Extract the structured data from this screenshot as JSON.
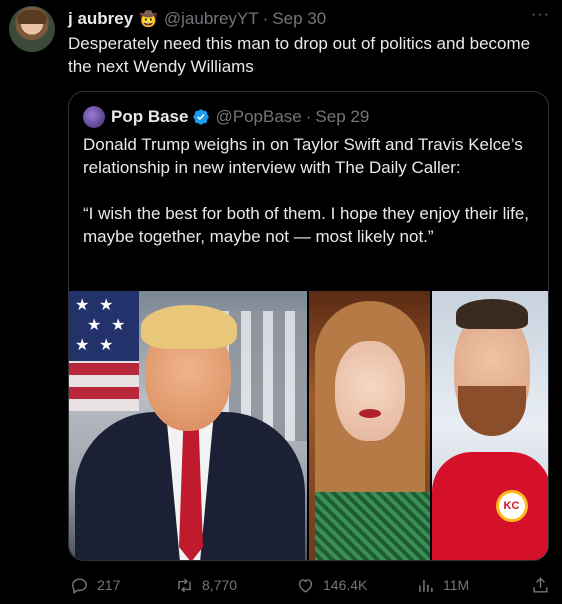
{
  "tweet": {
    "author_name": "j aubrey",
    "author_emoji": "🤠",
    "handle": "@jaubreyYT",
    "separator": "·",
    "date": "Sep 30",
    "more_label": "···",
    "text": "Desperately need this man to drop out of politics and become the next Wendy Williams"
  },
  "quote": {
    "author_name": "Pop Base",
    "handle": "@PopBase",
    "separator": "·",
    "date": "Sep 29",
    "text": "Donald Trump weighs in on Taylor Swift and Travis Kelce’s relationship in new interview with The Daily Caller:\n\n“I wish the best for both of them. I hope they enjoy their life, maybe together, maybe not — most likely not.”",
    "images": [
      "trump-photo",
      "taylor-swift-photo",
      "travis-kelce-photo"
    ]
  },
  "actions": {
    "replies": "217",
    "retweets": "8,770",
    "likes": "146.4K",
    "views": "11M"
  },
  "colors": {
    "background": "#000000",
    "text": "#e7e9ea",
    "muted": "#71767b",
    "border": "#2f3336",
    "verified": "#1d9bf0"
  },
  "icons": [
    "reply-icon",
    "retweet-icon",
    "like-icon",
    "views-icon",
    "share-icon",
    "verified-icon",
    "more-icon"
  ]
}
